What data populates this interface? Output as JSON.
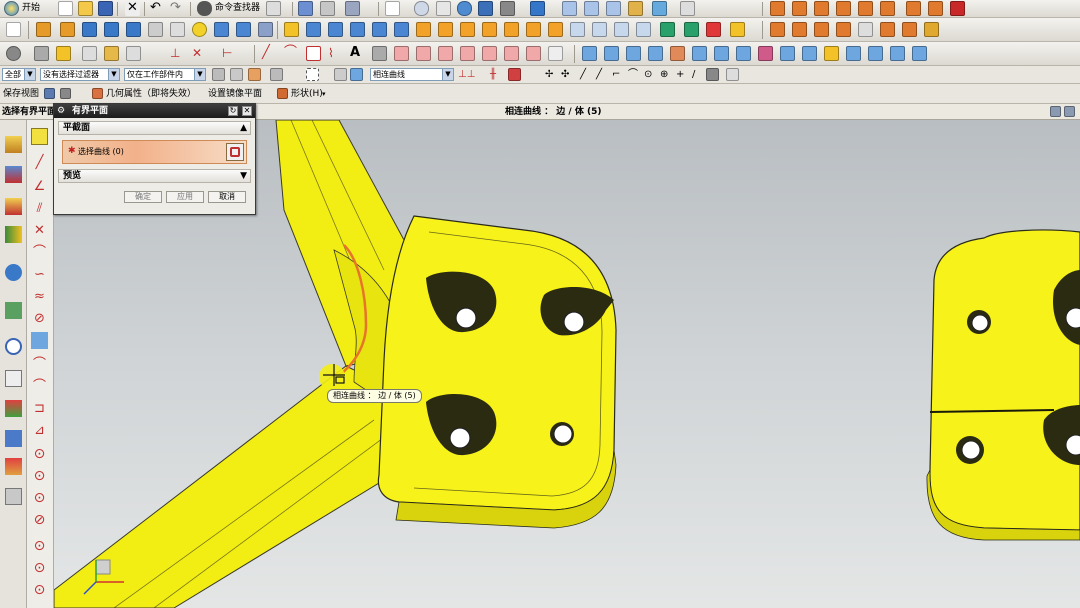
{
  "menu": {
    "start_label": "开始",
    "command_finder_label": "命令查找器"
  },
  "selection_bar": {
    "type_filter": "全部",
    "no_filter": "没有选择过滤器",
    "scope": "仅在工作部件内",
    "curve_rule": "相连曲线"
  },
  "quick_bar": {
    "save_view": "保存视图",
    "geometry_props": "几何属性（即将失效）",
    "set_mirror_plane": "设置镜像平面",
    "shape": "形状(H)"
  },
  "status": {
    "prompt": "选择有界平面",
    "selection_info": "相连曲线 ： 边 / 体 (5)"
  },
  "dialog": {
    "title": "有界平面",
    "section_plane": "平截面",
    "select_curve": "选择曲线 (0)",
    "section_preview": "预览",
    "ok": "确定",
    "apply": "应用",
    "cancel": "取消"
  },
  "viewport": {
    "tooltip": "相连曲线 ： 边 / 体 (5)",
    "part_color": "#f5f000",
    "highlight_color": "#e8742a"
  }
}
